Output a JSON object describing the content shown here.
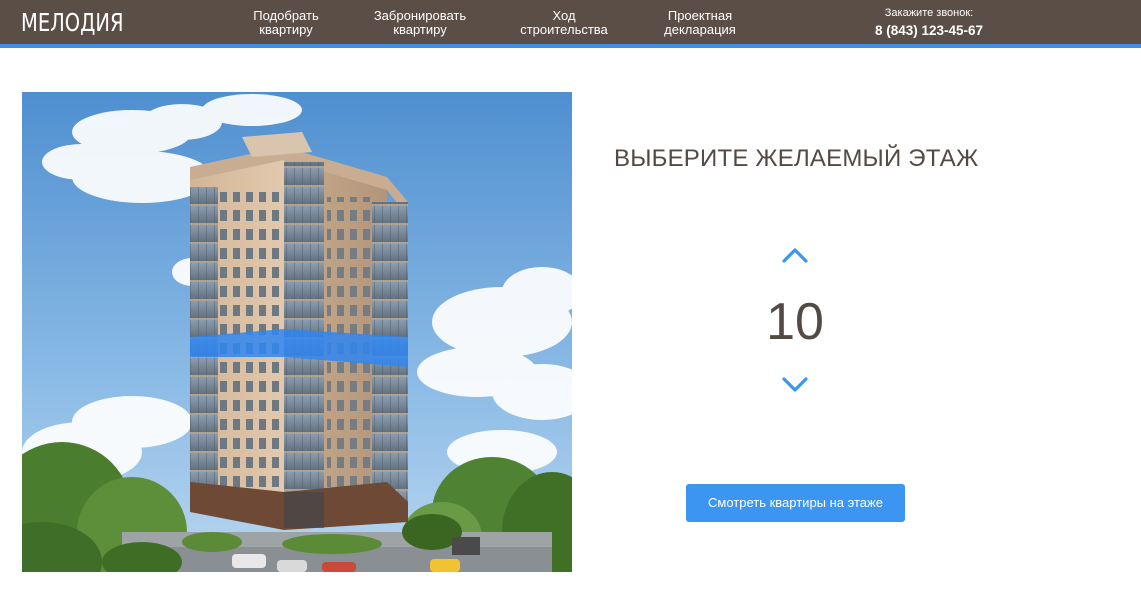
{
  "header": {
    "logo": "МЕЛОДИЯ",
    "nav": [
      {
        "line1": "Подобрать",
        "line2": "квартиру"
      },
      {
        "line1": "Забронировать",
        "line2": "квартиру"
      },
      {
        "line1": "Ход",
        "line2": "строительства"
      },
      {
        "line1": "Проектная",
        "line2": "декларация"
      }
    ],
    "callback_label": "Закажите звонок:",
    "phone": "8 (843) 123-45-67"
  },
  "floor_selector": {
    "title": "ВЫБЕРИТЕ ЖЕЛАЕМЫЙ ЭТАЖ",
    "current_floor": "10",
    "button_label": "Смотреть квартиры на этаже"
  },
  "colors": {
    "header_bg": "#5a4e47",
    "accent": "#3f8fe8",
    "text_dark": "#534a45"
  },
  "icons": {
    "up": "chevron-up-icon",
    "down": "chevron-down-icon"
  }
}
